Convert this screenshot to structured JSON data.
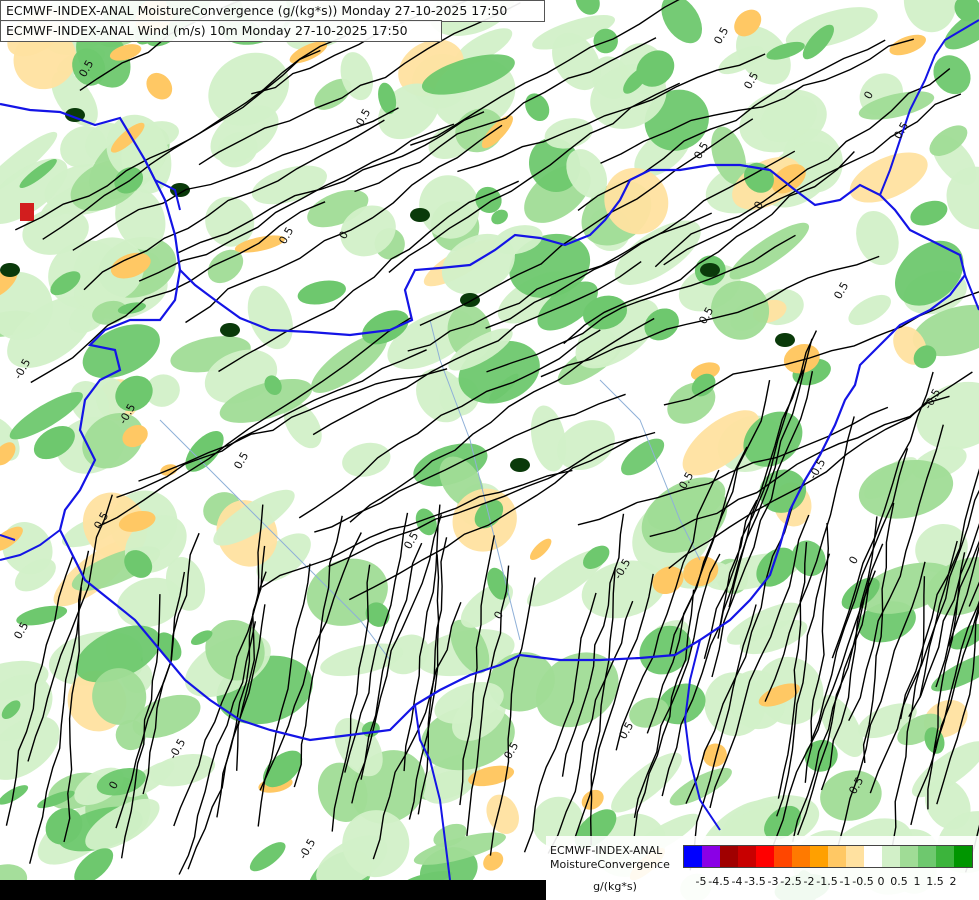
{
  "titles": {
    "line1": "ECMWF-INDEX-ANAL MoistureConvergence (g/(kg*s)) Monday 27-10-2025 17:50",
    "line2": "ECMWF-INDEX-ANAL Wind (m/s) 10m Monday 27-10-2025 17:50"
  },
  "legend": {
    "name_line1": "ECMWF-INDEX-ANAL",
    "name_line2": "MoistureConvergence",
    "units": "g/(kg*s)",
    "colors": [
      "#0000ff",
      "#8a00e6",
      "#a00000",
      "#c80000",
      "#ff0000",
      "#ff4600",
      "#ff7a00",
      "#ffa000",
      "#ffc864",
      "#ffe1a0",
      "#ffffff",
      "#d2f0c8",
      "#a0dc96",
      "#6ec86e",
      "#3cb43c",
      "#009600"
    ],
    "ticks": [
      "-5",
      "-4.5",
      "-4",
      "-3.5",
      "-3",
      "-2.5",
      "-2",
      "-1.5",
      "-1",
      "-0.5",
      "0",
      "0.5",
      "1",
      "1.5",
      "2"
    ]
  },
  "map": {
    "contour_labels": [
      "0.5",
      "-0.5",
      "0",
      "0.5",
      "-0.5",
      "0.5",
      "0",
      "0.5",
      "-0.5",
      "0.5",
      "0",
      "-0.5",
      "0.5",
      "0.5",
      "0",
      "-0.5",
      "0.5",
      "0.5",
      "-0.5",
      "0",
      "0.5",
      "0.5",
      "-0.5",
      "0.5",
      "0.5",
      "0",
      "0.5",
      "0.5",
      "-0.5",
      "0.5"
    ],
    "border_color": "#0000ff",
    "streamline_color": "#000000"
  }
}
